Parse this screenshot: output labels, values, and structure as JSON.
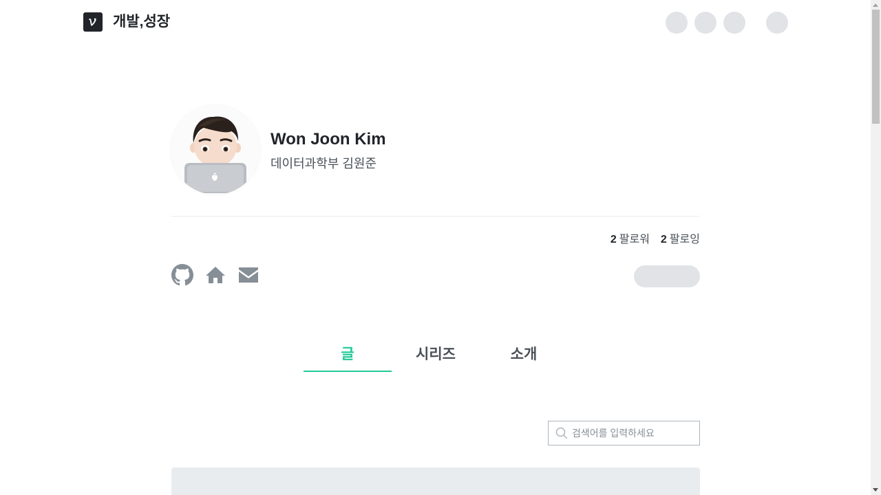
{
  "header": {
    "blog_title": "개발,성장",
    "logo_icon": "velog-v-logo-icon"
  },
  "profile": {
    "name": "Won Joon Kim",
    "bio": "데이터과학부 김원준",
    "avatar_icon": "memoji-avatar"
  },
  "follow": {
    "followers_count": "2",
    "followers_label": "팔로워",
    "following_count": "2",
    "following_label": "팔로잉"
  },
  "social_icons": [
    "github-icon",
    "home-icon",
    "mail-icon"
  ],
  "tabs": [
    {
      "label": "글",
      "active": true
    },
    {
      "label": "시리즈",
      "active": false
    },
    {
      "label": "소개",
      "active": false
    }
  ],
  "search": {
    "placeholder": "검색어를 입력하세요",
    "value": ""
  },
  "colors": {
    "accent": "#20c997",
    "text": "#212529",
    "muted": "#495057",
    "skeleton": "#e1e3e7"
  }
}
